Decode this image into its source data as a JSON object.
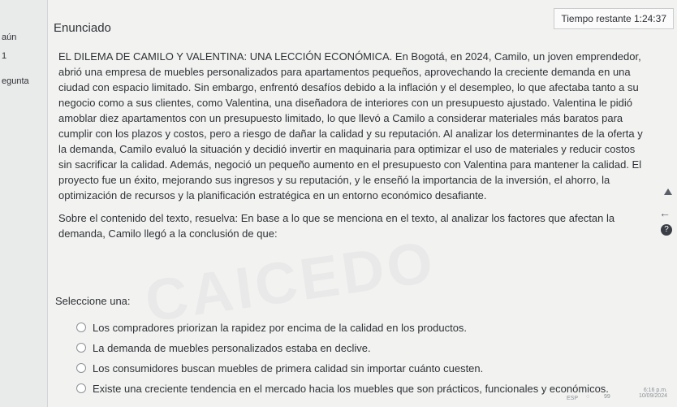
{
  "sidebar": {
    "line1": "aún",
    "line2": "1",
    "line3": "egunta"
  },
  "header": {
    "title": "Enunciado",
    "timer": "Tiempo restante 1:24:37"
  },
  "question": {
    "paragraph": "EL DILEMA DE CAMILO Y VALENTINA: UNA LECCIÓN ECONÓMICA. En Bogotá, en 2024, Camilo, un joven emprendedor, abrió una empresa de muebles personalizados para apartamentos pequeños, aprovechando la creciente demanda en una ciudad con espacio limitado. Sin embargo, enfrentó desafíos debido a la inflación y el desempleo, lo que afectaba tanto a su negocio como a sus clientes, como Valentina, una diseñadora de interiores con un presupuesto ajustado. Valentina le pidió amoblar diez apartamentos con un presupuesto limitado, lo que llevó a Camilo a considerar materiales más baratos para cumplir con los plazos y costos, pero a riesgo de dañar la calidad y su reputación. Al analizar los determinantes de la oferta y la demanda, Camilo evaluó la situación y decidió invertir en maquinaria para optimizar el uso de materiales y reducir costos sin sacrificar la calidad. Además, negoció un pequeño aumento en el presupuesto con Valentina para mantener la calidad. El proyecto fue un éxito, mejorando sus ingresos y su reputación, y le enseñó la importancia de la inversión, el ahorro, la optimización de recursos y la planificación estratégica en un entorno económico desafiante.",
    "prompt": "Sobre el contenido del texto, resuelva: En base a lo que se menciona en el texto, al analizar los factores que afectan la demanda, Camilo llegó a la conclusión de que:",
    "select_label": "Seleccione una:",
    "options": [
      "Los compradores priorizan la rapidez por encima de la calidad en los productos.",
      "La demanda de muebles personalizados estaba en declive.",
      "Los consumidores buscan muebles de primera calidad sin importar cuánto cuesten.",
      "Existe una creciente tendencia en el mercado hacia los muebles que son prácticos, funcionales y económicos."
    ]
  },
  "watermark": "CAICEDO",
  "icons": {
    "up": "chevron-up-icon",
    "back": "back-arrow-icon",
    "help": "help-icon"
  },
  "taskbar": {
    "lang": "ESP",
    "battery": "99",
    "time": "6:16 p.m.",
    "date": "10/09/2024"
  }
}
